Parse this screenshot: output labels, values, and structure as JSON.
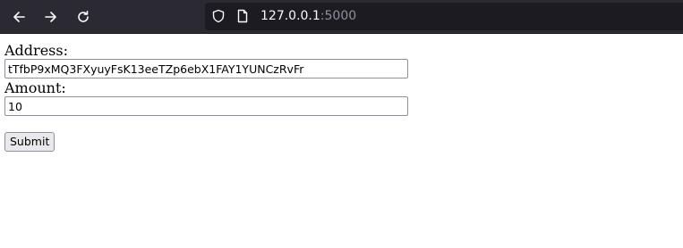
{
  "browser": {
    "url_host": "127.0.0.1",
    "url_port": ":5000",
    "icons": {
      "back": "back-arrow-icon",
      "forward": "forward-arrow-icon",
      "reload": "reload-icon",
      "shield": "shield-icon",
      "page": "page-icon"
    },
    "colors": {
      "toolbar": "#2b2a33",
      "urlbar": "#1c1b22"
    }
  },
  "form": {
    "address_label": "Address:",
    "address_value": "tTfbP9xMQ3FXyuyFsK13eeTZp6ebX1FAY1YUNCzRvFr",
    "amount_label": "Amount:",
    "amount_value": "10",
    "submit_label": "Submit"
  }
}
